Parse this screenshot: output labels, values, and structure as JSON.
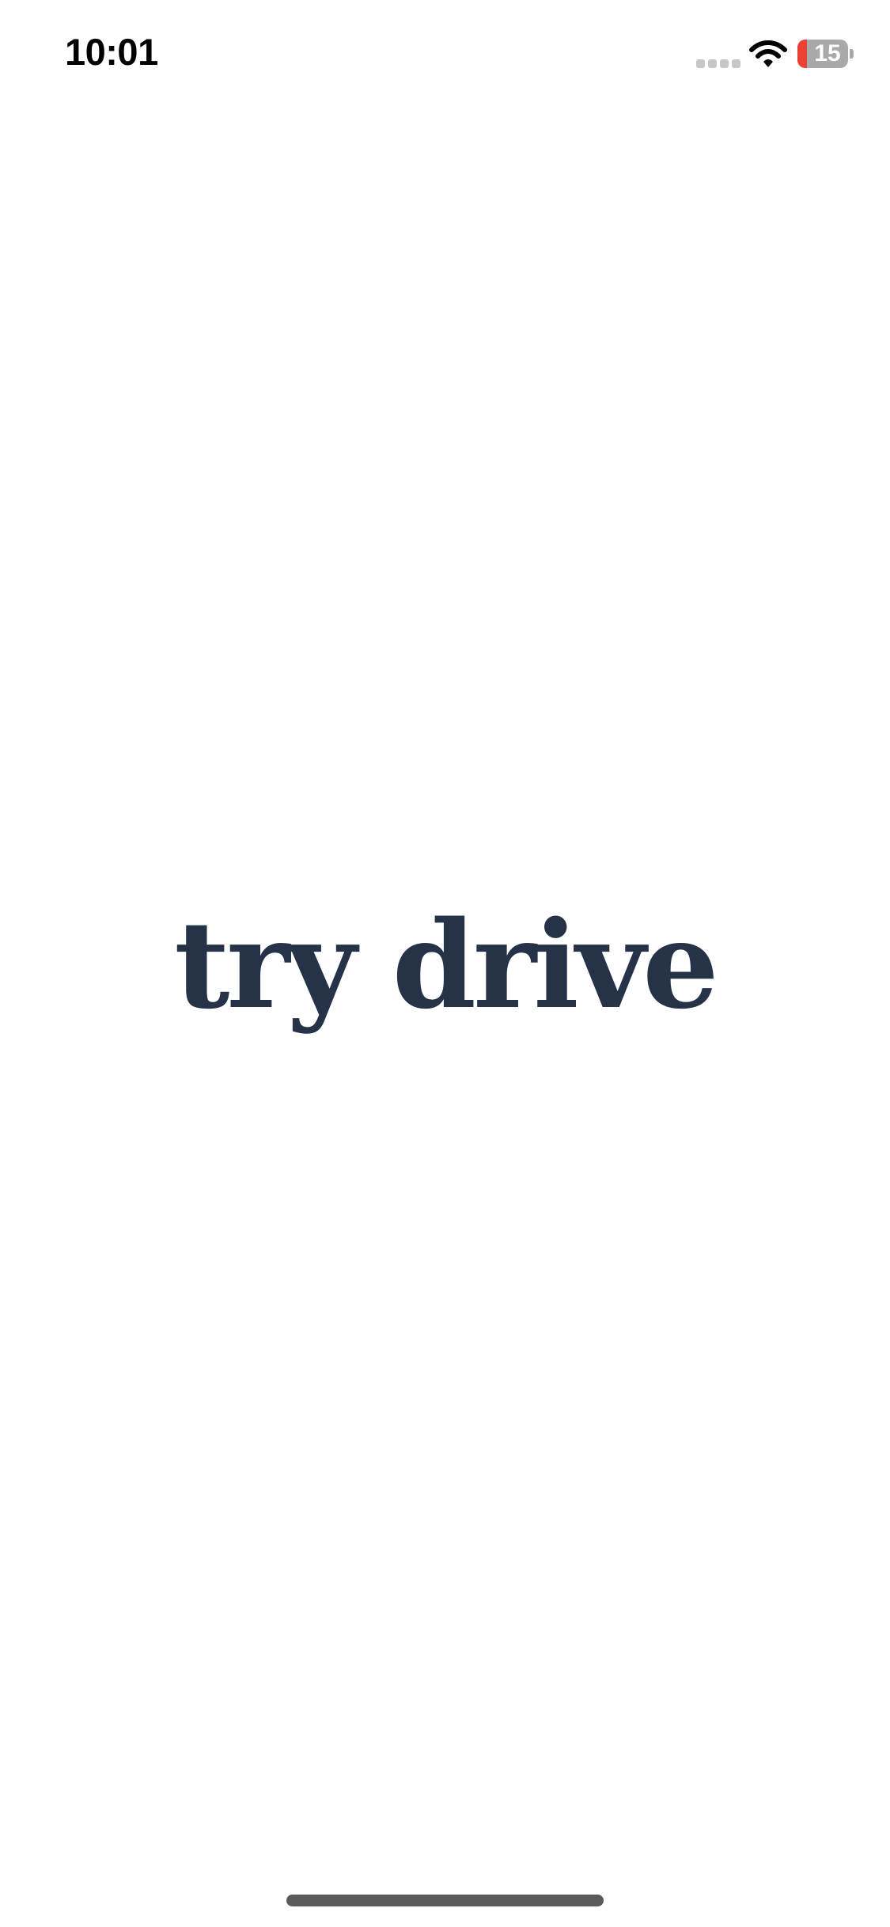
{
  "status_bar": {
    "time": "10:01",
    "battery_level": "15",
    "signal_icon": "signal-icon",
    "wifi_icon": "wifi-icon",
    "battery_icon": "battery-icon"
  },
  "splash": {
    "logo_text": "try drive"
  },
  "colors": {
    "logo": "#263248",
    "background": "#ffffff",
    "battery_low": "#eb4034",
    "battery_body": "#a9a9a9"
  }
}
